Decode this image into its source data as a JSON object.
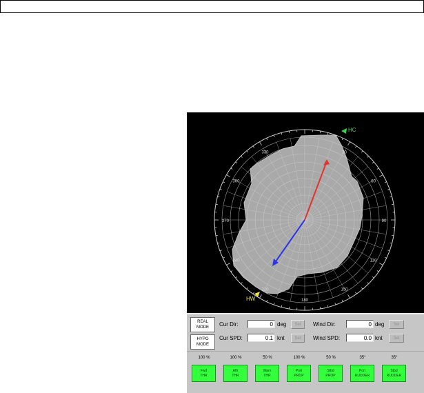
{
  "polar": {
    "heading_marker": "HC",
    "wind_marker": "HW",
    "bearing_labels": [
      "330",
      "30",
      "60",
      "90",
      "120",
      "150",
      "180",
      "210",
      "240",
      "270",
      "300"
    ],
    "colors": {
      "background": "#000000",
      "envelope": "#a9a9a9",
      "grid": "#cfcfcf",
      "heading_vector": "#e0332d",
      "drift_vector": "#2e35e6",
      "hc_marker": "#35d447",
      "hw_marker": "#f3e53a"
    }
  },
  "controls": {
    "real_mode": "REAL\nMODE",
    "hypo_mode": "HYPO\nMODE",
    "cur_dir_label": "Cur Dir:",
    "cur_dir_value": "0",
    "cur_dir_unit": "deg",
    "cur_spd_label": "Cur SPD:",
    "cur_spd_value": "0.1",
    "cur_spd_unit": "knt",
    "wind_dir_label": "Wind Dir:",
    "wind_dir_value": "0",
    "wind_dir_unit": "deg",
    "wind_spd_label": "Wind SPD:",
    "wind_spd_value": "0.0",
    "wind_spd_unit": "knt",
    "set_label": "Set"
  },
  "thrusters": [
    {
      "value": "100 %",
      "label": "Fwd\nTHR"
    },
    {
      "value": "100 %",
      "label": "Aftr\nTHR"
    },
    {
      "value": "50 %",
      "label": "Warn\nTHR"
    },
    {
      "value": "100 %",
      "label": "Port\nPROP"
    },
    {
      "value": "50 %",
      "label": "Stbd\nPROP"
    },
    {
      "value": "35°",
      "label": "Port\nRUDDER"
    },
    {
      "value": "35°",
      "label": "Stbd\nRUDDER"
    }
  ]
}
